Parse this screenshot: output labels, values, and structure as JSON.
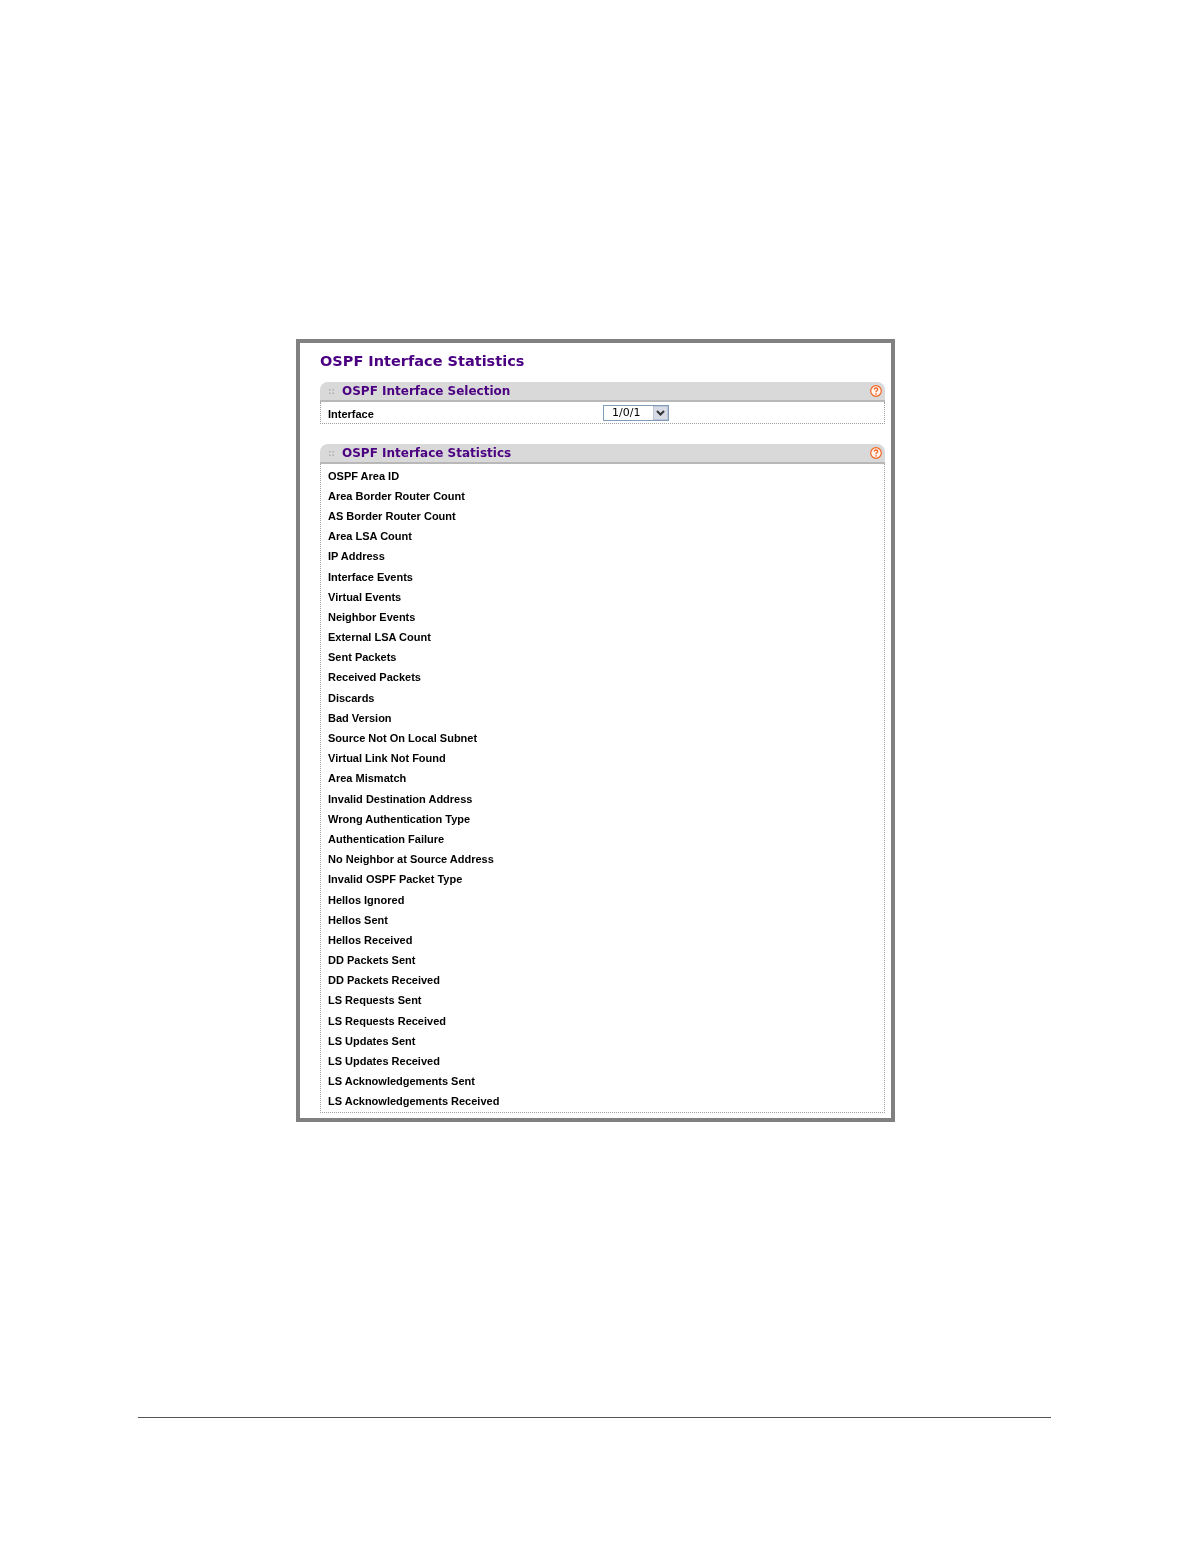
{
  "page_title": "OSPF Interface Statistics",
  "sections": [
    {
      "kind": "selection",
      "title": "OSPF Interface Selection",
      "fields": [
        {
          "label": "Interface",
          "value": "1/0/1"
        }
      ]
    },
    {
      "kind": "statistics",
      "title": "OSPF Interface Statistics",
      "rows": [
        "OSPF Area ID",
        "Area Border Router Count",
        "AS Border Router Count",
        "Area LSA Count",
        "IP Address",
        "Interface Events",
        "Virtual Events",
        "Neighbor Events",
        "External LSA Count",
        "Sent Packets",
        "Received Packets",
        "Discards",
        "Bad Version",
        "Source Not On Local Subnet",
        "Virtual Link Not Found",
        "Area Mismatch",
        "Invalid Destination Address",
        "Wrong Authentication Type",
        "Authentication Failure",
        "No Neighbor at Source Address",
        "Invalid OSPF Packet Type",
        "Hellos Ignored",
        "Hellos Sent",
        "Hellos Received",
        "DD Packets Sent",
        "DD Packets Received",
        "LS Requests Sent",
        "LS Requests Received",
        "LS Updates Sent",
        "LS Updates Received",
        "LS Acknowledgements Sent",
        "LS Acknowledgements Received"
      ]
    }
  ]
}
